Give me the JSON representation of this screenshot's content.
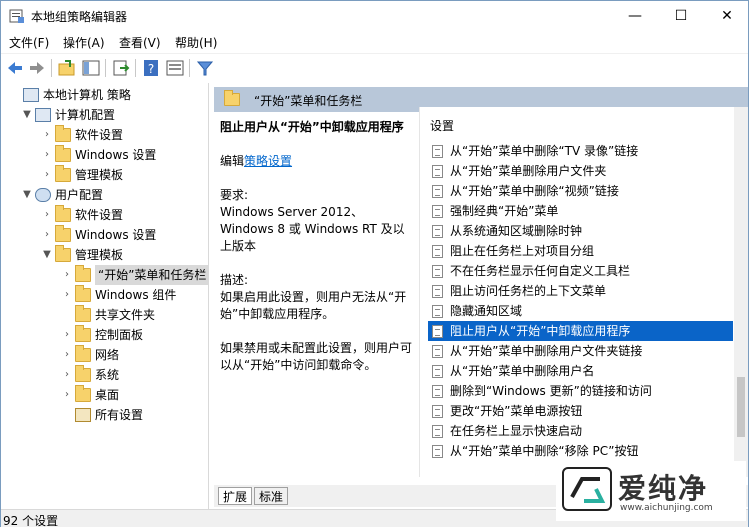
{
  "window": {
    "title": "本地组策略编辑器",
    "controls": [
      "—",
      "☐",
      "✕"
    ]
  },
  "menu": [
    "文件(F)",
    "操作(A)",
    "查看(V)",
    "帮助(H)"
  ],
  "tree": [
    {
      "label": "本地计算机 策略",
      "level": 0,
      "arrow": "",
      "icon": "computer"
    },
    {
      "label": "计算机配置",
      "level": 1,
      "arrow": "▼",
      "icon": "computer"
    },
    {
      "label": "软件设置",
      "level": 2,
      "arrow": "›",
      "icon": "folder"
    },
    {
      "label": "Windows 设置",
      "level": 2,
      "arrow": "›",
      "icon": "folder"
    },
    {
      "label": "管理模板",
      "level": 2,
      "arrow": "›",
      "icon": "folder"
    },
    {
      "label": "用户配置",
      "level": 1,
      "arrow": "▼",
      "icon": "user"
    },
    {
      "label": "软件设置",
      "level": 2,
      "arrow": "›",
      "icon": "folder"
    },
    {
      "label": "Windows 设置",
      "level": 2,
      "arrow": "›",
      "icon": "folder"
    },
    {
      "label": "管理模板",
      "level": 2,
      "arrow": "▼",
      "icon": "folder"
    },
    {
      "label": "“开始”菜单和任务栏",
      "level": 3,
      "arrow": "›",
      "icon": "folder",
      "selected": true
    },
    {
      "label": "Windows 组件",
      "level": 3,
      "arrow": "›",
      "icon": "folder"
    },
    {
      "label": "共享文件夹",
      "level": 3,
      "arrow": "",
      "icon": "folder"
    },
    {
      "label": "控制面板",
      "level": 3,
      "arrow": "›",
      "icon": "folder"
    },
    {
      "label": "网络",
      "level": 3,
      "arrow": "›",
      "icon": "folder"
    },
    {
      "label": "系统",
      "level": 3,
      "arrow": "›",
      "icon": "folder"
    },
    {
      "label": "桌面",
      "level": 3,
      "arrow": "›",
      "icon": "folder"
    },
    {
      "label": "所有设置",
      "level": 3,
      "arrow": "",
      "icon": "settings"
    }
  ],
  "right": {
    "header": "“开始”菜单和任务栏",
    "desc_title": "阻止用户从“开始”中卸载应用程序",
    "edit_prefix": "编辑",
    "edit_link": "策略设置",
    "req_label": "要求:",
    "req_text": "Windows Server 2012、Windows 8 或 Windows RT 及以上版本",
    "desc_label": "描述:",
    "desc_text1": "如果启用此设置，则用户无法从“开始”中卸载应用程序。",
    "desc_text2": "如果禁用或未配置此设置，则用户可以从“开始”中访问卸载命令。",
    "list_header": "设置",
    "items": [
      "从“开始”菜单中删除“TV 录像”链接",
      "从“开始”菜单删除用户文件夹",
      "从“开始”菜单中删除“视频”链接",
      "强制经典“开始”菜单",
      "从系统通知区域删除时钟",
      "阻止在任务栏上对项目分组",
      "不在任务栏显示任何自定义工具栏",
      "阻止访问任务栏的上下文菜单",
      "隐藏通知区域",
      "阻止用户从“开始”中卸载应用程序",
      "从“开始”菜单中删除用户文件夹链接",
      "从“开始”菜单中删除用户名",
      "删除到“Windows 更新”的链接和访问",
      "更改“开始”菜单电源按钮",
      "在任务栏上显示快速启动",
      "从“开始”菜单中删除“移除 PC”按钮"
    ],
    "selected_index": 9,
    "tabs": [
      "扩展",
      "标准"
    ]
  },
  "status": "92 个设置",
  "watermark": {
    "text": "爱纯净",
    "url": "www.aichunjing.com"
  }
}
